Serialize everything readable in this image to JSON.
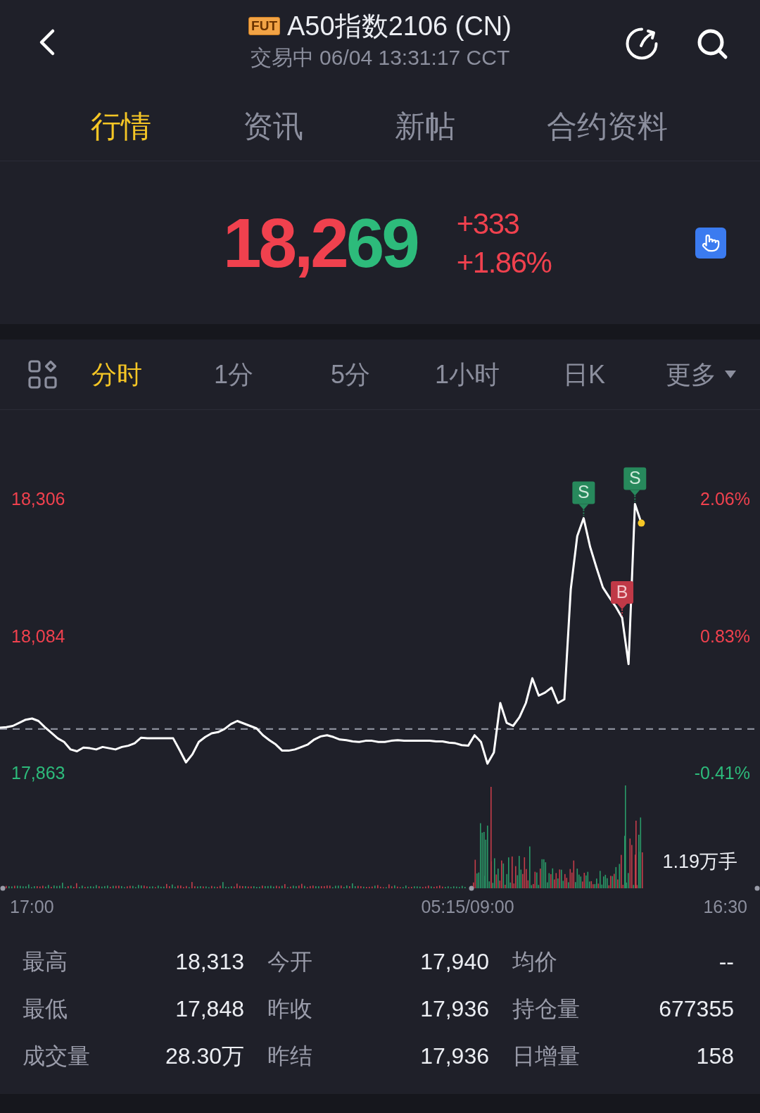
{
  "header": {
    "badge": "FUT",
    "title": "A50指数2106 (CN)",
    "status": "交易中 06/04 13:31:17 CCT"
  },
  "tabs": [
    {
      "label": "行情",
      "selected": true
    },
    {
      "label": "资讯",
      "selected": false
    },
    {
      "label": "新帖",
      "selected": false
    },
    {
      "label": "合约资料",
      "selected": false
    }
  ],
  "quote": {
    "price_parts": [
      {
        "text": "18,2",
        "color": "#f0414e"
      },
      {
        "text": "69",
        "color": "#2dbb7b"
      }
    ],
    "change": "+333",
    "change_percent": "+1.86%"
  },
  "periods": [
    {
      "label": "分时",
      "kind": "period",
      "selected": true
    },
    {
      "label": "1分",
      "kind": "period",
      "selected": false
    },
    {
      "label": "5分",
      "kind": "period",
      "selected": false
    },
    {
      "label": "1小时",
      "kind": "period",
      "selected": false
    },
    {
      "label": "日K",
      "kind": "period",
      "selected": false
    },
    {
      "label": "更多",
      "kind": "dropdown",
      "selected": false
    }
  ],
  "chart": {
    "chart_data": {
      "type": "line",
      "ylim": [
        17315,
        19115
      ],
      "yticks": [
        {
          "value": 18306,
          "label": "18,306"
        },
        {
          "value": 18084,
          "label": "18,084"
        },
        {
          "value": 17863,
          "label": "17,863"
        }
      ],
      "values": [
        17938,
        17939,
        17941,
        17946,
        17951,
        17953,
        17949,
        17939,
        17930,
        17921,
        17915,
        17903,
        17900,
        17906,
        17905,
        17903,
        17907,
        17905,
        17903,
        17907,
        17909,
        17913,
        17922,
        17921,
        17921,
        17921,
        17921,
        17921,
        17902,
        17882,
        17895,
        17915,
        17923,
        17929,
        17931,
        17936,
        17944,
        17949,
        17945,
        17941,
        17937,
        17926,
        17918,
        17911,
        17901,
        17901,
        17903,
        17907,
        17911,
        17919,
        17924,
        17926,
        17923,
        17919,
        17918,
        17916,
        17915,
        17917,
        17917,
        17915,
        17915,
        17917,
        17918,
        17917,
        17917,
        17917,
        17917,
        17917,
        17916,
        17916,
        17914,
        17913,
        17910,
        17909,
        17926,
        17915,
        17880,
        17898,
        17978,
        17946,
        17941,
        17955,
        17978,
        18018,
        17990,
        17995,
        18003,
        17978,
        17984,
        18162,
        18248,
        18277,
        18231,
        18197,
        18165,
        18149,
        18134,
        18116,
        18041,
        18300,
        18269
      ],
      "ref_lines": [
        {
          "axis": "y",
          "value": 17936
        }
      ]
    },
    "percent_labels": [
      "2.06%",
      "0.83%",
      "-0.41%"
    ],
    "trade_markers": [
      {
        "text": "S",
        "kind": "sell"
      },
      {
        "text": "B",
        "kind": "buy"
      },
      {
        "text": "S",
        "kind": "sell"
      }
    ],
    "volume_label": "1.19万手",
    "time_labels": [
      "17:00",
      "05:15/09:00",
      "16:30"
    ]
  },
  "stats": [
    {
      "label": "最高",
      "value": "18,313"
    },
    {
      "label": "今开",
      "value": "17,940"
    },
    {
      "label": "均价",
      "value": "--"
    },
    {
      "label": "最低",
      "value": "17,848"
    },
    {
      "label": "昨收",
      "value": "17,936"
    },
    {
      "label": "持仓量",
      "value": "677355"
    },
    {
      "label": "成交量",
      "value": "28.30万"
    },
    {
      "label": "昨结",
      "value": "17,936"
    },
    {
      "label": "日增量",
      "value": "158"
    }
  ]
}
